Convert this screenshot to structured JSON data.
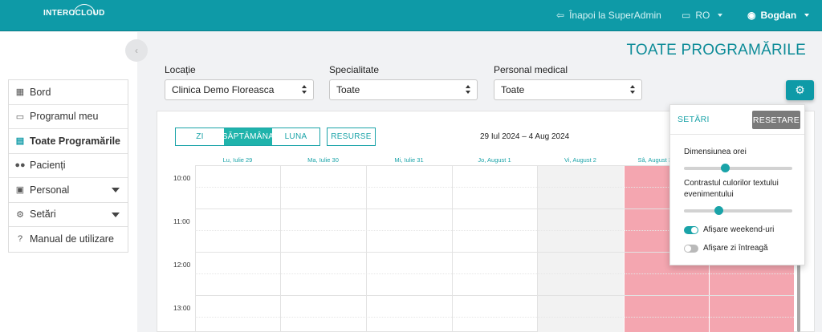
{
  "brand": "INTEROCLOUD",
  "topnav": {
    "back_label": "Înapoi la SuperAdmin",
    "language": "RO",
    "user": "Bogdan"
  },
  "sidebar": {
    "items": [
      {
        "label": "Bord",
        "icon": "dashboard-icon"
      },
      {
        "label": "Programul meu",
        "icon": "calendar-icon"
      },
      {
        "label": "Toate Programările",
        "icon": "calendar-check-icon",
        "active": true
      },
      {
        "label": "Pacienți",
        "icon": "users-icon"
      },
      {
        "label": "Personal",
        "icon": "id-card-icon",
        "expandable": true
      },
      {
        "label": "Setări",
        "icon": "gear-icon",
        "expandable": true
      },
      {
        "label": "Manual de utilizare",
        "icon": "help-icon"
      }
    ]
  },
  "page": {
    "title": "TOATE PROGRAMĂRILE"
  },
  "filters": {
    "location_label": "Locație",
    "location_value": "Clinica Demo Floreasca",
    "specialty_label": "Specialitate",
    "specialty_value": "Toate",
    "staff_label": "Personal medical",
    "staff_value": "Toate"
  },
  "calendar": {
    "views": [
      "ZI",
      "SĂPTĂMÂNA",
      "LUNA"
    ],
    "selected_view": "SĂPTĂMÂNA",
    "resources_label": "RESURSE",
    "range": "29 Iul 2024 – 4 Aug 2024",
    "days": [
      "Lu, Iulie 29",
      "Ma, Iulie 30",
      "Mi, Iulie 31",
      "Jo, August 1",
      "Vi, August 2",
      "Sâ, August 3"
    ],
    "times": [
      "10:00",
      "11:00",
      "12:00",
      "13:00"
    ]
  },
  "settings_popup": {
    "title": "SETĂRI",
    "reset_label": "RESETARE",
    "hour_size_label": "Dimensiunea orei",
    "hour_size_level": 0.38,
    "contrast_label": "Contrastul culorilor textului evenimentului",
    "contrast_level": 0.32,
    "weekend_label": "Afișare weekend-uri",
    "weekend_on": true,
    "fullday_label": "Afișare zi întreagă",
    "fullday_on": false
  },
  "colors": {
    "primary": "#0e9aa7",
    "accent": "#1fb3ab",
    "weekend_saturday": "#f4a6b0",
    "friday_bg": "#f2f2f2",
    "reset_btn": "#7a7a7a"
  }
}
